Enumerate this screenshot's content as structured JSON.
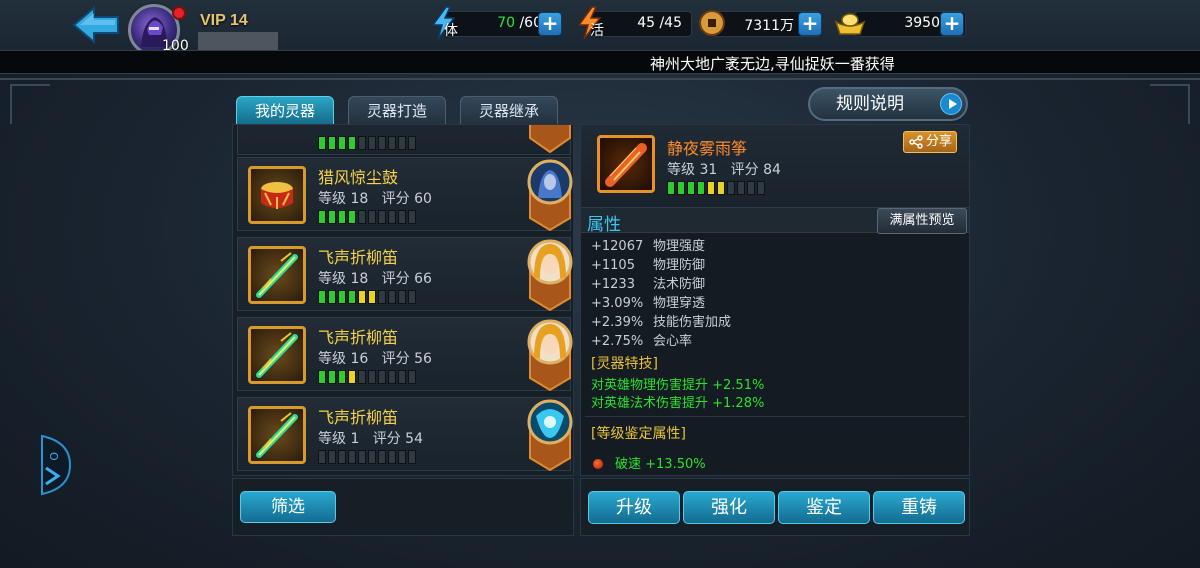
{
  "player": {
    "level": "100",
    "vip": "VIP 14"
  },
  "resources": {
    "stamina": {
      "label": "体",
      "current": "70",
      "max": " /60"
    },
    "vitality": {
      "label": "活",
      "value": "45 /45"
    },
    "coins": {
      "value": "7311万"
    },
    "gold": {
      "value": "3950"
    }
  },
  "marquee": "神州大地广袤无边,寻仙捉妖一番获得",
  "tabs": [
    "我的灵器",
    "灵器打造",
    "灵器继承"
  ],
  "rules_button": "规则说明",
  "list": {
    "items": [
      {
        "name": "猎风惊尘鼓",
        "level_label": "等级 18",
        "score_label": "评分 60",
        "green": 4,
        "yellow": 0,
        "icon": "drum-icon",
        "hero": "blue-hero-portrait"
      },
      {
        "name": "飞声折柳笛",
        "level_label": "等级 18",
        "score_label": "评分 66",
        "green": 4,
        "yellow": 2,
        "icon": "flute-icon",
        "hero": "blonde-hero-portrait"
      },
      {
        "name": "飞声折柳笛",
        "level_label": "等级 16",
        "score_label": "评分 56",
        "green": 3,
        "yellow": 1,
        "icon": "flute-icon",
        "hero": "blonde-hero-portrait"
      },
      {
        "name": "飞声折柳笛",
        "level_label": "等级 1",
        "score_label": "评分 54",
        "green": 0,
        "yellow": 0,
        "icon": "flute-icon",
        "hero": "cyan-hero-portrait"
      }
    ],
    "filter_button": "筛选"
  },
  "detail": {
    "name": "静夜雾雨筝",
    "level_label": "等级 31",
    "score_label": "评分 84",
    "green": 4,
    "yellow": 2,
    "share": "分享",
    "attr_title": "属性",
    "preview_button": "满属性预览",
    "attributes": [
      {
        "value": "+12067",
        "name": "物理强度"
      },
      {
        "value": "+1105",
        "name": "物理防御"
      },
      {
        "value": "+1233",
        "name": "法术防御"
      },
      {
        "value": "+3.09%",
        "name": "物理穿透"
      },
      {
        "value": "+2.39%",
        "name": "技能伤害加成"
      },
      {
        "value": "+2.75%",
        "name": "会心率"
      }
    ],
    "skill_title": "[灵器特技]",
    "skills": [
      "对英雄物理伤害提升 +2.51%",
      "对英雄法术伤害提升 +1.28%"
    ],
    "appraise_title": "[等级鉴定属性]",
    "appraise": "破速 +13.50%"
  },
  "actions": [
    "升级",
    "强化",
    "鉴定",
    "重铸"
  ],
  "colors": {
    "accent": "#2aa8d0",
    "gold_text": "#f7d24a",
    "green_text": "#2ce22c",
    "orange_name": "#ff8a2a"
  }
}
